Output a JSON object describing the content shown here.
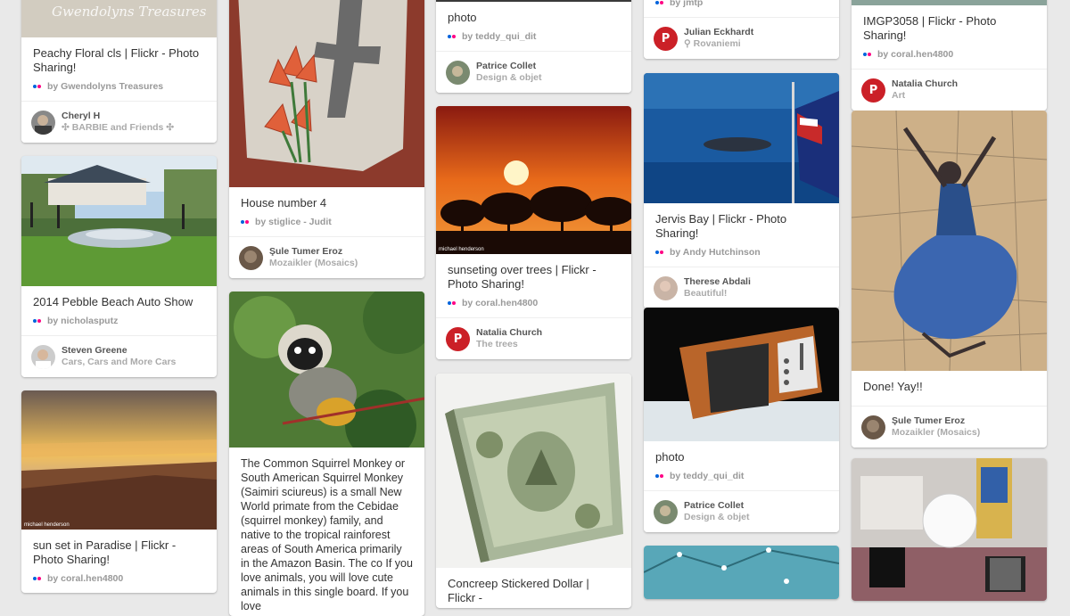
{
  "pins": [
    {
      "id": "c1p1",
      "watermark": "Gwendolyns Treasures",
      "title": "Peachy Floral cls | Flickr - Photo Sharing!",
      "credit": "by Gwendolyns Treasures",
      "user": "Cheryl H",
      "board": "✣ BARBIE and Friends ✣"
    },
    {
      "id": "c1p2",
      "title": "2014 Pebble Beach Auto Show",
      "credit": "by nicholasputz",
      "user": "Steven Greene",
      "board": "Cars, Cars and More Cars"
    },
    {
      "id": "c1p3",
      "title": "sun set in Paradise | Flickr - Photo Sharing!",
      "credit": "by coral.hen4800"
    },
    {
      "id": "c2p1",
      "title": "House number 4",
      "credit": "by stiglice - Judit",
      "user": "Şule Tumer Eroz",
      "board": "Mozaikler (Mosaics)"
    },
    {
      "id": "c2p2",
      "desc": "The Common Squirrel Monkey or South American Squirrel Monkey (Saimiri sciureus) is a small New World primate from the Cebidae (squirrel monkey) family, and native to the tropical rainforest areas of South America primarily in the Amazon Basin. The co If you love animals, you will love cute animals in this single board. If you love"
    },
    {
      "id": "c3p1",
      "title": "photo",
      "credit": "by teddy_qui_dit",
      "user": "Patrice Collet",
      "board": "Design & objet"
    },
    {
      "id": "c3p2",
      "title": "sunseting over trees | Flickr - Photo Sharing!",
      "credit": "by coral.hen4800",
      "user": "Natalia Church",
      "board": "The trees"
    },
    {
      "id": "c3p3",
      "title": "Concreep Stickered Dollar | Flickr -"
    },
    {
      "id": "c4p1",
      "credit": "by jmtp",
      "user": "Julian Eckhardt",
      "board": "Rovaniemi"
    },
    {
      "id": "c4p2",
      "title": "Jervis Bay | Flickr - Photo Sharing!",
      "credit": "by Andy Hutchinson",
      "user": "Therese Abdali",
      "board": "Beautiful!"
    },
    {
      "id": "c4p3",
      "title": "photo",
      "credit": "by teddy_qui_dit",
      "user": "Patrice Collet",
      "board": "Design & objet"
    },
    {
      "id": "c5p1",
      "title": "IMGP3058 | Flickr - Photo Sharing!",
      "credit": "by coral.hen4800",
      "user": "Natalia Church",
      "board": "Art"
    },
    {
      "id": "c5p2",
      "title": "Done! Yay!!",
      "user": "Şule Tumer Eroz",
      "board": "Mozaikler (Mosaics)"
    }
  ],
  "photo_watermark": "michael henderson",
  "colors": {
    "flickr_blue": "#0063dc",
    "flickr_pink": "#ff0084",
    "pinterest_red": "#cb2027",
    "background": "#e9e9e9"
  }
}
